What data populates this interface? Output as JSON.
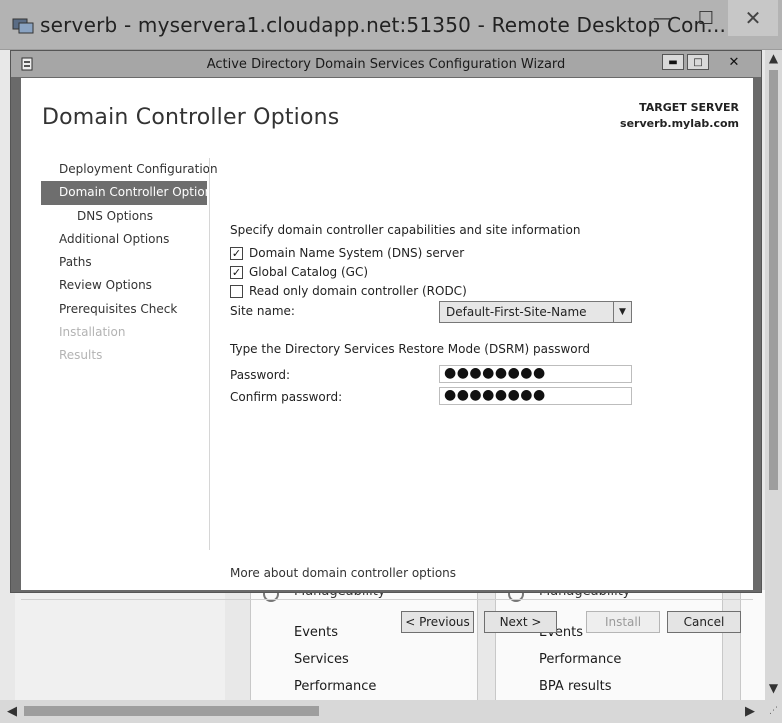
{
  "rdp": {
    "title": "serverb - myservera1.cloudapp.net:51350 - Remote Desktop Con...",
    "minimize": "—",
    "maximize": "☐",
    "close": "✕"
  },
  "wizard": {
    "title": "Active Directory Domain Services Configuration Wizard",
    "page_title": "Domain Controller Options",
    "target_label": "TARGET SERVER",
    "target_value": "serverb.mylab.com",
    "nav": [
      {
        "label": "Deployment Configuration",
        "state": "normal"
      },
      {
        "label": "Domain Controller Options",
        "state": "active"
      },
      {
        "label": "DNS Options",
        "state": "sub"
      },
      {
        "label": "Additional Options",
        "state": "normal"
      },
      {
        "label": "Paths",
        "state": "normal"
      },
      {
        "label": "Review Options",
        "state": "normal"
      },
      {
        "label": "Prerequisites Check",
        "state": "normal"
      },
      {
        "label": "Installation",
        "state": "disabled"
      },
      {
        "label": "Results",
        "state": "disabled"
      }
    ],
    "intro": "Specify domain controller capabilities and site information",
    "checkboxes": [
      {
        "label": "Domain Name System (DNS) server",
        "checked": true,
        "mark": "✓"
      },
      {
        "label": "Global Catalog (GC)",
        "checked": true,
        "mark": "✓"
      },
      {
        "label": "Read only domain controller (RODC)",
        "checked": false,
        "mark": ""
      }
    ],
    "site_name_label": "Site name:",
    "site_name_value": "Default-First-Site-Name",
    "dsrm_label": "Type the Directory Services Restore Mode (DSRM) password",
    "password_label": "Password:",
    "password_value": "●●●●●●●●",
    "confirm_label": "Confirm password:",
    "confirm_value": "●●●●●●●●",
    "more_link": "More about domain controller options",
    "buttons": {
      "previous": "< Previous",
      "next": "Next >",
      "install": "Install",
      "cancel": "Cancel"
    }
  },
  "background": {
    "panel1_header": "Manageability",
    "panel1_items": [
      "Events",
      "Services",
      "Performance"
    ],
    "panel2_header": "Manageability",
    "panel2_items": [
      "Events",
      "Performance",
      "BPA results"
    ]
  },
  "colors": {
    "selected_nav": "#6e6e6e",
    "titlebar": "#b3b3b3"
  }
}
